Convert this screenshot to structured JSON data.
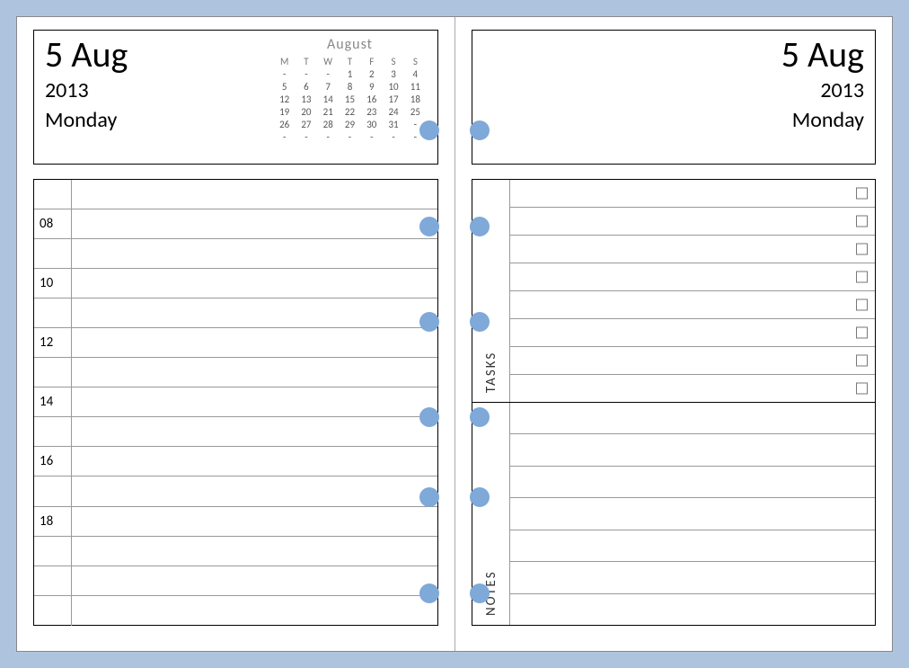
{
  "date": {
    "main": "5 Aug",
    "year": "2013",
    "day": "Monday"
  },
  "mini_calendar": {
    "title": "August",
    "dow": [
      "M",
      "T",
      "W",
      "T",
      "F",
      "S",
      "S"
    ],
    "rows": [
      [
        "-",
        "-",
        "-",
        "1",
        "2",
        "3",
        "4"
      ],
      [
        "5",
        "6",
        "7",
        "8",
        "9",
        "10",
        "11"
      ],
      [
        "12",
        "13",
        "14",
        "15",
        "16",
        "17",
        "18"
      ],
      [
        "19",
        "20",
        "21",
        "22",
        "23",
        "24",
        "25"
      ],
      [
        "26",
        "27",
        "28",
        "29",
        "30",
        "31",
        "-"
      ],
      [
        "-",
        "-",
        "-",
        "-",
        "-",
        "-",
        "-"
      ]
    ]
  },
  "schedule_hours": [
    "",
    "08",
    "",
    "10",
    "",
    "12",
    "",
    "14",
    "",
    "16",
    "",
    "18",
    "",
    "",
    ""
  ],
  "sections": {
    "tasks_label": "TASKS",
    "notes_label": "NOTES",
    "task_rows": 8,
    "note_rows": 7
  },
  "hole_positions": [
    115,
    222,
    328,
    434,
    523,
    630
  ]
}
